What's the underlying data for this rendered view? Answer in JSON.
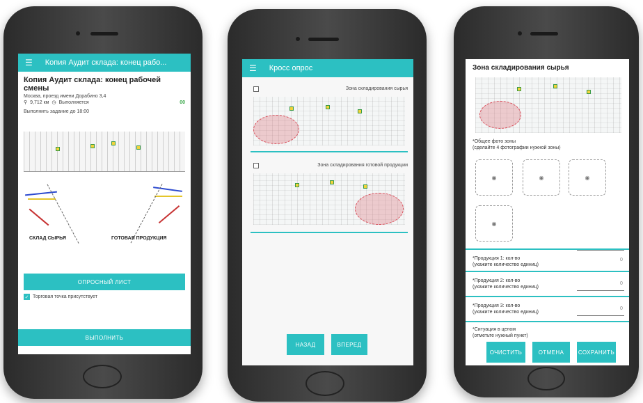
{
  "screen1": {
    "title": "Копия Аудит склада: конец рабо...",
    "heading": "Копия Аудит склада: конец рабочей смены",
    "address": "Москва, проезд имени Дорабино 3,4",
    "distance": "9,712 км",
    "status": "Выполняется",
    "status_code": "00",
    "deadline": "Выполнить задание до 18:00",
    "label_left": "СКЛАД СЫРЬЯ",
    "label_right": "ГОТОВАЯ ПРОДУКЦИЯ",
    "survey_button": "ОПРОСНЫЙ ЛИСТ",
    "checkbox_label": "Торговая точка присутствует",
    "complete_button": "ВЫПОЛНИТЬ"
  },
  "screen2": {
    "title": "Кросс опрос",
    "zone1": "Зона складирования сырья",
    "zone2": "Зона складирования готовой продукции",
    "back_button": "НАЗАД",
    "forward_button": "ВПЕРЕД"
  },
  "screen3": {
    "title": "Зона складирования сырья",
    "photo_label": "*Общее фото зоны",
    "photo_hint": "(сделайте 4 фотографии нужной зоны)",
    "q1": "*Продукция 1: кол-во",
    "q1_hint": "(укажите количество единиц)",
    "q1_value": "0",
    "q2": "*Продукция 2: кол-во",
    "q2_hint": "(укажите количество единиц)",
    "q2_value": "0",
    "q3": "*Продукция 3: кол-во",
    "q3_hint": "(укажите количество единиц)",
    "q3_value": "0",
    "q4": "*Ситуация в целом",
    "q4_hint": "(отметьте нужный пункт)",
    "clear_button": "ОЧИСТИТЬ",
    "cancel_button": "ОТМЕНА",
    "save_button": "СОХРАНИТЬ"
  },
  "colors": {
    "accent": "#2cc0c2",
    "zone_red": "#d84c58"
  }
}
